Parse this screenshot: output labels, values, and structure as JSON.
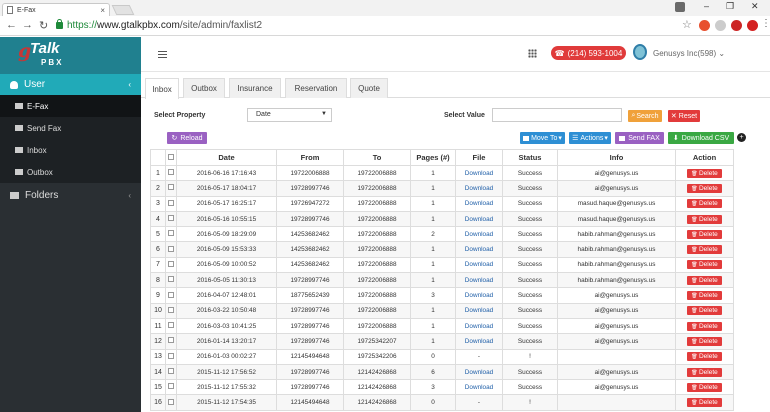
{
  "browser": {
    "tab_title": "E-Fax",
    "tab_close": "×",
    "url_scheme": "https://",
    "url_domain": "www.gtalkpbx.com",
    "url_path": "/site/admin/faxlist2"
  },
  "logo": {
    "g": "g",
    "talk": "Talk",
    "pbx": "PBX"
  },
  "sidebar": {
    "user_label": "User",
    "items": [
      {
        "label": "E-Fax"
      },
      {
        "label": "Send Fax"
      },
      {
        "label": "Inbox"
      },
      {
        "label": "Outbox"
      }
    ],
    "folders_label": "Folders"
  },
  "header": {
    "phone": "(214) 593-1004",
    "company": "Genusys Inc(598)"
  },
  "tabs": [
    "Inbox",
    "Outbox",
    "Insurance",
    "Reservation",
    "Quote"
  ],
  "filters": {
    "select_property_label": "Select Property",
    "property_value": "Date",
    "select_value_label": "Select Value",
    "search_label": "Search",
    "reset_label": "Reset"
  },
  "actions": {
    "reload": "Reload",
    "move_to": "Move To",
    "actions": "Actions",
    "send_fax": "Send FAX",
    "download_csv": "Download CSV"
  },
  "table": {
    "headers": [
      "",
      "",
      "Date",
      "From",
      "To",
      "Pages (#)",
      "File",
      "Status",
      "Info",
      "Action"
    ],
    "delete_label": "Delete",
    "rows": [
      {
        "n": "1",
        "date": "2016-06-16 17:16:43",
        "from": "19722006888",
        "to": "19722006888",
        "pages": "1",
        "file": "Download",
        "status": "Success",
        "info": "ai@genusys.us"
      },
      {
        "n": "2",
        "date": "2016-05-17 18:04:17",
        "from": "19728997746",
        "to": "19722006888",
        "pages": "1",
        "file": "Download",
        "status": "Success",
        "info": "ai@genusys.us"
      },
      {
        "n": "3",
        "date": "2016-05-17 16:25:17",
        "from": "19726947272",
        "to": "19722006888",
        "pages": "1",
        "file": "Download",
        "status": "Success",
        "info": "masud.haque@genusys.us"
      },
      {
        "n": "4",
        "date": "2016-05-16 10:55:15",
        "from": "19728997746",
        "to": "19722006888",
        "pages": "1",
        "file": "Download",
        "status": "Success",
        "info": "masud.haque@genusys.us"
      },
      {
        "n": "5",
        "date": "2016-05-09 18:29:09",
        "from": "14253682462",
        "to": "19722006888",
        "pages": "2",
        "file": "Download",
        "status": "Success",
        "info": "habib.rahman@genusys.us"
      },
      {
        "n": "6",
        "date": "2016-05-09 15:53:33",
        "from": "14253682462",
        "to": "19722006888",
        "pages": "1",
        "file": "Download",
        "status": "Success",
        "info": "habib.rahman@genusys.us"
      },
      {
        "n": "7",
        "date": "2016-05-09 10:00:52",
        "from": "14253682462",
        "to": "19722006888",
        "pages": "1",
        "file": "Download",
        "status": "Success",
        "info": "habib.rahman@genusys.us"
      },
      {
        "n": "8",
        "date": "2016-05-05 11:30:13",
        "from": "19728997746",
        "to": "19722006888",
        "pages": "1",
        "file": "Download",
        "status": "Success",
        "info": "habib.rahman@genusys.us"
      },
      {
        "n": "9",
        "date": "2016-04-07 12:48:01",
        "from": "18775652439",
        "to": "19722006888",
        "pages": "3",
        "file": "Download",
        "status": "Success",
        "info": "ai@genusys.us"
      },
      {
        "n": "10",
        "date": "2016-03-22 10:50:48",
        "from": "19728997746",
        "to": "19722006888",
        "pages": "1",
        "file": "Download",
        "status": "Success",
        "info": "ai@genusys.us"
      },
      {
        "n": "11",
        "date": "2016-03-03 10:41:25",
        "from": "19728997746",
        "to": "19722006888",
        "pages": "1",
        "file": "Download",
        "status": "Success",
        "info": "ai@genusys.us"
      },
      {
        "n": "12",
        "date": "2016-01-14 13:20:17",
        "from": "19728997746",
        "to": "19725342207",
        "pages": "1",
        "file": "Download",
        "status": "Success",
        "info": "ai@genusys.us"
      },
      {
        "n": "13",
        "date": "2016-01-03 00:02:27",
        "from": "12145494648",
        "to": "19725342206",
        "pages": "0",
        "file": "-",
        "status": "!",
        "info": ""
      },
      {
        "n": "14",
        "date": "2015-11-12 17:56:52",
        "from": "19728997746",
        "to": "12142426868",
        "pages": "6",
        "file": "Download",
        "status": "Success",
        "info": "ai@genusys.us"
      },
      {
        "n": "15",
        "date": "2015-11-12 17:55:32",
        "from": "19728997746",
        "to": "12142426868",
        "pages": "3",
        "file": "Download",
        "status": "Success",
        "info": "ai@genusys.us"
      },
      {
        "n": "16",
        "date": "2015-11-12 17:54:35",
        "from": "12145494648",
        "to": "12142426868",
        "pages": "0",
        "file": "-",
        "status": "!",
        "info": ""
      }
    ]
  }
}
